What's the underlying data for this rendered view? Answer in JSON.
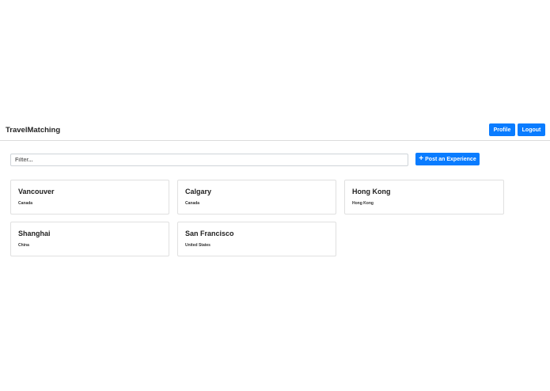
{
  "header": {
    "brand": "TravelMatching",
    "profile_label": "Profile",
    "logout_label": "Logout"
  },
  "toolbar": {
    "filter_placeholder": "Filter...",
    "filter_value": "",
    "post_icon": "plus-icon",
    "post_symbol": "+",
    "post_label": "Post an Experience"
  },
  "cards": [
    {
      "city": "Vancouver",
      "country": "Canada"
    },
    {
      "city": "Calgary",
      "country": "Canada"
    },
    {
      "city": "Hong Kong",
      "country": "Hong Kong"
    },
    {
      "city": "Shanghai",
      "country": "China"
    },
    {
      "city": "San Francisco",
      "country": "United States"
    }
  ],
  "colors": {
    "accent": "#0a7cff",
    "border": "#e0e0e0",
    "text": "#222222"
  }
}
